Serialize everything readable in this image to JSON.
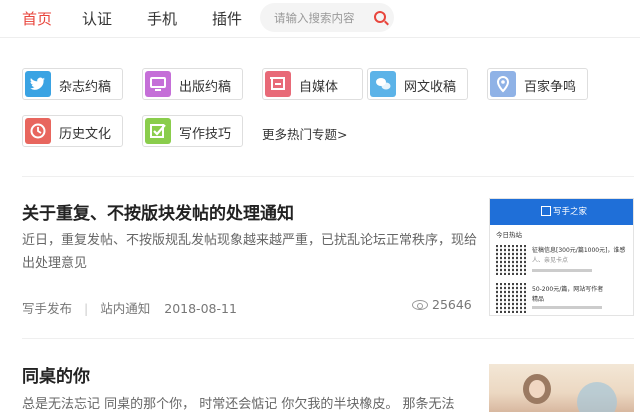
{
  "nav": {
    "items": [
      {
        "label": "首页",
        "active": true
      },
      {
        "label": "认证",
        "active": false
      },
      {
        "label": "手机",
        "active": false
      },
      {
        "label": "插件",
        "active": false
      }
    ],
    "search_placeholder": "请输入搜索内容"
  },
  "topics": [
    {
      "label": "杂志约稿",
      "icon": "twitter-bird-icon",
      "color": "#3aa3e3"
    },
    {
      "label": "出版约稿",
      "icon": "monitor-icon",
      "color": "#c56fd8"
    },
    {
      "label": "自媒体",
      "icon": "shopping-cart-icon",
      "color": "#e86a78"
    },
    {
      "label": "网文收稿",
      "icon": "chat-bubbles-icon",
      "color": "#5cb3e8"
    },
    {
      "label": "百家争鸣",
      "icon": "location-pin-icon",
      "color": "#8fb2e6"
    },
    {
      "label": "历史文化",
      "icon": "clock-icon",
      "color": "#e8665e"
    },
    {
      "label": "写作技巧",
      "icon": "check-icon",
      "color": "#8acd4c"
    }
  ],
  "more_topics": "更多热门专题>",
  "articles": [
    {
      "title": "关于重复、不按版块发帖的处理通知",
      "excerpt": "近日，重复发帖、不按版规乱发帖现象越来越严重，已扰乱论坛正常秩序，现给出处理意见",
      "author": "写手发布",
      "category": "站内通知",
      "date": "2018-08-11",
      "views": "25646",
      "thumb": {
        "site": "写手之家",
        "subhead": "今日热站",
        "item1": "征稿信息[300元/篇1000元]，谁感",
        "item1b": "人、亲见卡点",
        "item2": "50-200元/篇，网站写作者",
        "item2b": "精品"
      }
    },
    {
      "title": "同桌的你",
      "excerpt": "总是无法忘记 同桌的那个你， 时常还会惦记 你欠我的半块橡皮。 那条无法"
    }
  ]
}
